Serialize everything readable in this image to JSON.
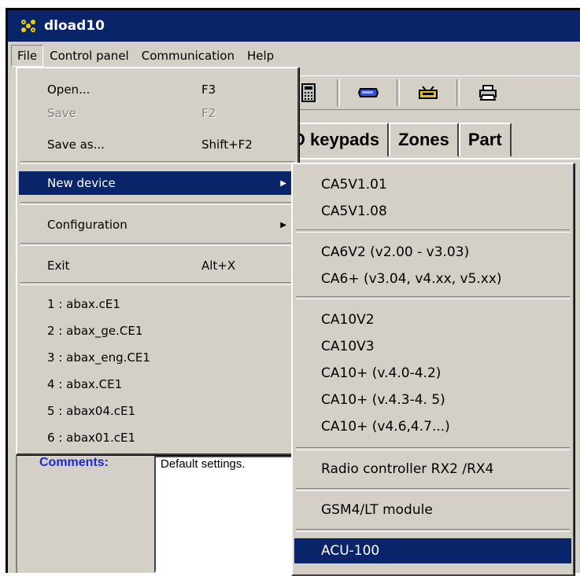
{
  "window": {
    "title": "dload10"
  },
  "menubar": {
    "items": [
      "File",
      "Control panel",
      "Communication",
      "Help"
    ]
  },
  "tabs": [
    "D keypads",
    "Zones",
    "Part"
  ],
  "comments": {
    "label": "Comments:",
    "text": "Default settings."
  },
  "file_menu": {
    "open": {
      "label": "Open...",
      "shortcut": "F3"
    },
    "save": {
      "label": "Save",
      "shortcut": "F2"
    },
    "save_as": {
      "label": "Save as...",
      "shortcut": "Shift+F2"
    },
    "new_device": {
      "label": "New device"
    },
    "configuration": {
      "label": "Configuration"
    },
    "exit": {
      "label": "Exit",
      "shortcut": "Alt+X"
    },
    "recent": [
      "1 : abax.cE1",
      "2 : abax_ge.CE1",
      "3 : abax_eng.CE1",
      "4 : abax.CE1",
      "5 : abax04.cE1",
      "6 : abax01.cE1"
    ]
  },
  "new_device_menu": {
    "items": [
      "CA5V1.01",
      "CA5V1.08",
      "CA6V2 (v2.00 - v3.03)",
      "CA6+ (v3.04, v4.xx, v5.xx)",
      "CA10V2",
      "CA10V3",
      "CA10+ (v.4.0-4.2)",
      "CA10+ (v.4.3-4. 5)",
      "CA10+ (v4.6,4.7...)",
      "Radio controller RX2 /RX4",
      "GSM4/LT module",
      "ACU-100"
    ],
    "highlighted": "ACU-100"
  },
  "colors": {
    "titlebar": "#0a246a",
    "highlight": "#0a246a",
    "face": "#d4d0c8",
    "comments_label": "#1a2acc"
  },
  "icons": [
    "app-icon",
    "calculator-icon",
    "modem-icon",
    "connection-icon",
    "printer-icon"
  ]
}
